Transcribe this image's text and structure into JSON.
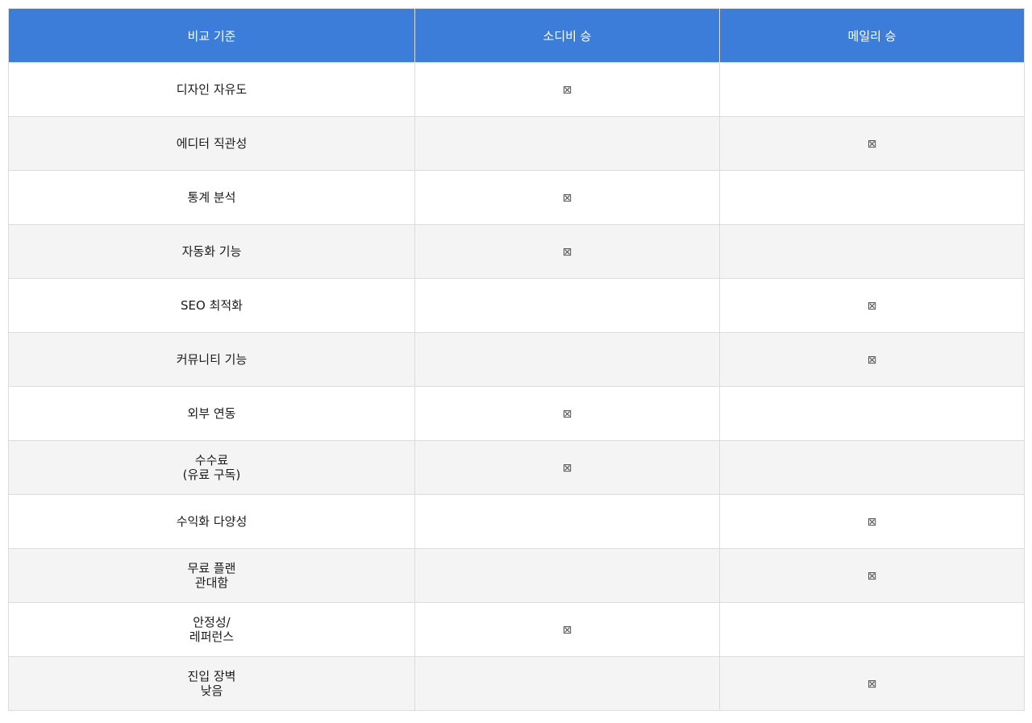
{
  "header": {
    "criteria": "비교 기준",
    "col_a": "소디비 승",
    "col_b": "메일리 승"
  },
  "mark_symbol": "⊠",
  "rows": [
    {
      "label": "디자인 자유도",
      "a": "⊠",
      "b": ""
    },
    {
      "label": "에디터 직관성",
      "a": "",
      "b": "⊠"
    },
    {
      "label": "통계 분석",
      "a": "⊠",
      "b": ""
    },
    {
      "label": "자동화 기능",
      "a": "⊠",
      "b": ""
    },
    {
      "label": "SEO 최적화",
      "a": "",
      "b": "⊠"
    },
    {
      "label": "커뮤니티 기능",
      "a": "",
      "b": "⊠"
    },
    {
      "label": "외부 연동",
      "a": "⊠",
      "b": ""
    },
    {
      "label": "수수료\n(유료 구독)",
      "a": "⊠",
      "b": ""
    },
    {
      "label": "수익화 다양성",
      "a": "",
      "b": "⊠"
    },
    {
      "label": "무료 플랜\n관대함",
      "a": "",
      "b": "⊠"
    },
    {
      "label": "안정성/\n레퍼런스",
      "a": "⊠",
      "b": ""
    },
    {
      "label": "진입 장벽\n낮음",
      "a": "",
      "b": "⊠"
    }
  ],
  "colors": {
    "header_bg": "#3b7dd8",
    "header_text": "#ffffff",
    "row_alt_bg": "#f4f4f4",
    "border": "#dcdcdc"
  }
}
